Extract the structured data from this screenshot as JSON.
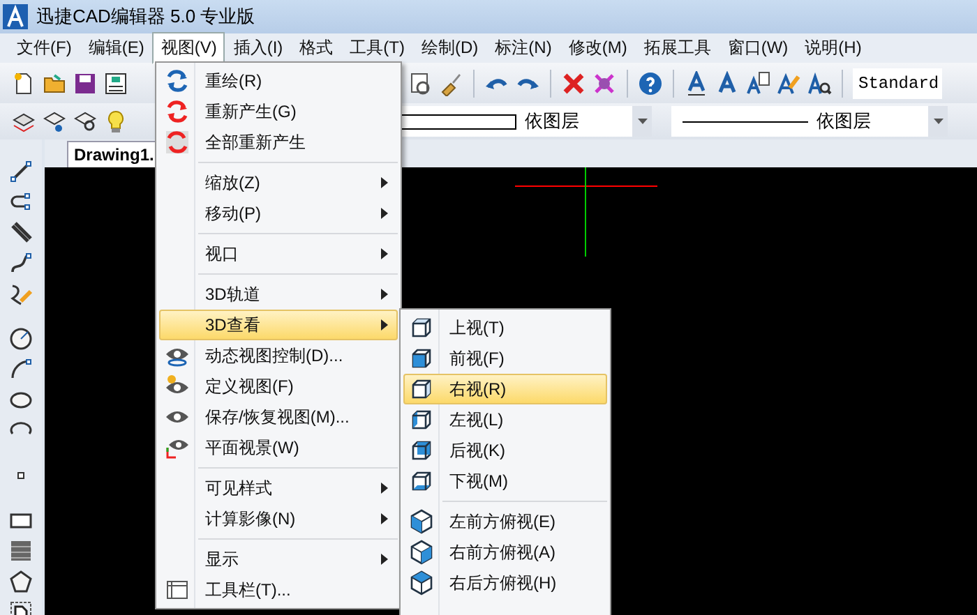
{
  "window": {
    "title": "迅捷CAD编辑器 5.0 专业版"
  },
  "menubar": [
    {
      "label": "文件(F)",
      "selected": false
    },
    {
      "label": "编辑(E)",
      "selected": false
    },
    {
      "label": "视图(V)",
      "selected": true
    },
    {
      "label": "插入(I)",
      "selected": false
    },
    {
      "label": "格式",
      "selected": false
    },
    {
      "label": "工具(T)",
      "selected": false
    },
    {
      "label": "绘制(D)",
      "selected": false
    },
    {
      "label": "标注(N)",
      "selected": false
    },
    {
      "label": "修改(M)",
      "selected": false
    },
    {
      "label": "拓展工具",
      "selected": false
    },
    {
      "label": "窗口(W)",
      "selected": false
    },
    {
      "label": "说明(H)",
      "selected": false
    }
  ],
  "toolbar": {
    "text_style": "Standard",
    "color_dropdown": "依图层",
    "linetype_dropdown": "依图层"
  },
  "tabs": [
    {
      "label": "Drawing1.",
      "selected": true
    }
  ],
  "view_menu": [
    {
      "kind": "item",
      "label": "重绘(R)",
      "submenu": false,
      "selected": false
    },
    {
      "kind": "item",
      "label": "重新产生(G)",
      "submenu": false,
      "selected": false
    },
    {
      "kind": "item",
      "label": "全部重新产生",
      "submenu": false,
      "selected": false
    },
    {
      "kind": "separator"
    },
    {
      "kind": "item",
      "label": "缩放(Z)",
      "submenu": true,
      "selected": false
    },
    {
      "kind": "item",
      "label": "移动(P)",
      "submenu": true,
      "selected": false
    },
    {
      "kind": "separator"
    },
    {
      "kind": "item",
      "label": "视口",
      "submenu": true,
      "selected": false
    },
    {
      "kind": "separator"
    },
    {
      "kind": "item",
      "label": "3D轨道",
      "submenu": true,
      "selected": false
    },
    {
      "kind": "item",
      "label": "3D查看",
      "submenu": true,
      "selected": true
    },
    {
      "kind": "item",
      "label": "动态视图控制(D)...",
      "submenu": false,
      "selected": false
    },
    {
      "kind": "item",
      "label": "定义视图(F)",
      "submenu": false,
      "selected": false
    },
    {
      "kind": "item",
      "label": "保存/恢复视图(M)...",
      "submenu": false,
      "selected": false
    },
    {
      "kind": "item",
      "label": "平面视景(W)",
      "submenu": false,
      "selected": false
    },
    {
      "kind": "separator"
    },
    {
      "kind": "item",
      "label": "可见样式",
      "submenu": true,
      "selected": false
    },
    {
      "kind": "item",
      "label": "计算影像(N)",
      "submenu": true,
      "selected": false
    },
    {
      "kind": "separator"
    },
    {
      "kind": "item",
      "label": "显示",
      "submenu": true,
      "selected": false
    },
    {
      "kind": "item",
      "label": "工具栏(T)...",
      "submenu": false,
      "selected": false
    }
  ],
  "view_3d_submenu": [
    {
      "kind": "item",
      "label": "上视(T)",
      "selected": false
    },
    {
      "kind": "item",
      "label": "前视(F)",
      "selected": false
    },
    {
      "kind": "item",
      "label": "右视(R)",
      "selected": true
    },
    {
      "kind": "item",
      "label": "左视(L)",
      "selected": false
    },
    {
      "kind": "item",
      "label": "后视(K)",
      "selected": false
    },
    {
      "kind": "item",
      "label": "下视(M)",
      "selected": false
    },
    {
      "kind": "separator"
    },
    {
      "kind": "item",
      "label": "左前方俯视(E)",
      "selected": false
    },
    {
      "kind": "item",
      "label": "右前方俯视(A)",
      "selected": false
    },
    {
      "kind": "item",
      "label": "右后方俯视(H)",
      "selected": false
    }
  ]
}
